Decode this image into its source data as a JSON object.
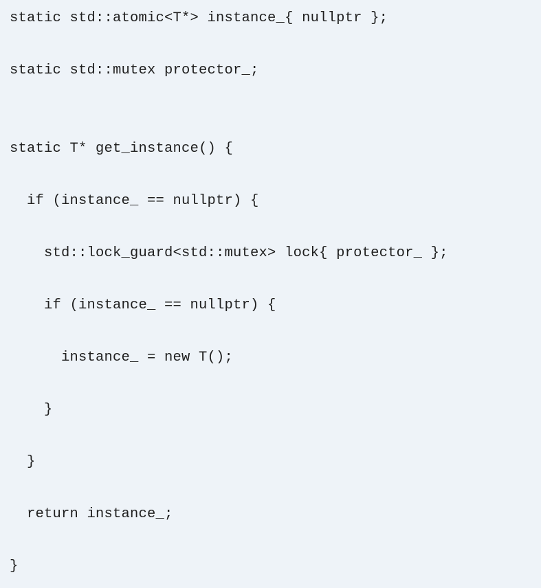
{
  "code": {
    "lines": [
      "static std::atomic<T*> instance_{ nullptr };",
      "static std::mutex protector_;",
      "",
      "static T* get_instance() {",
      "  if (instance_ == nullptr) {",
      "    std::lock_guard<std::mutex> lock{ protector_ };",
      "    if (instance_ == nullptr) {",
      "      instance_ = new T();",
      "    }",
      "  }",
      "  return instance_;",
      "}"
    ]
  }
}
